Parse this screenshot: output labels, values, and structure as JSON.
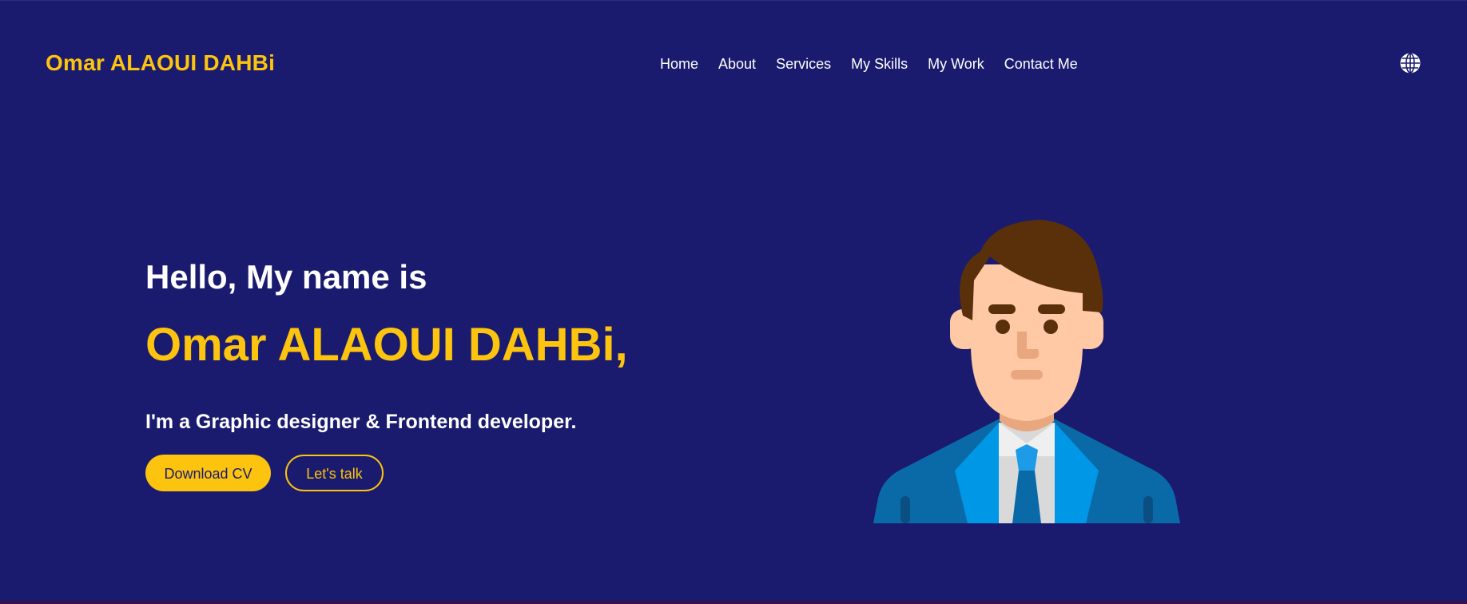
{
  "header": {
    "logo": "Omar ALAOUI DAHBi",
    "nav": [
      {
        "label": "Home"
      },
      {
        "label": "About"
      },
      {
        "label": "Services"
      },
      {
        "label": "My Skills"
      },
      {
        "label": "My Work"
      },
      {
        "label": "Contact Me"
      }
    ],
    "language_icon": "globe-icon"
  },
  "hero": {
    "greeting": "Hello, My name is",
    "name": "Omar ALAOUI DAHBi,",
    "role": "I'm a Graphic designer & Frontend developer.",
    "download_cv_label": "Download CV",
    "lets_talk_label": "Let's talk",
    "avatar_icon": "businessman-avatar"
  },
  "colors": {
    "background": "#1a1b6e",
    "accent": "#fcc40f",
    "text": "#ffffff"
  }
}
